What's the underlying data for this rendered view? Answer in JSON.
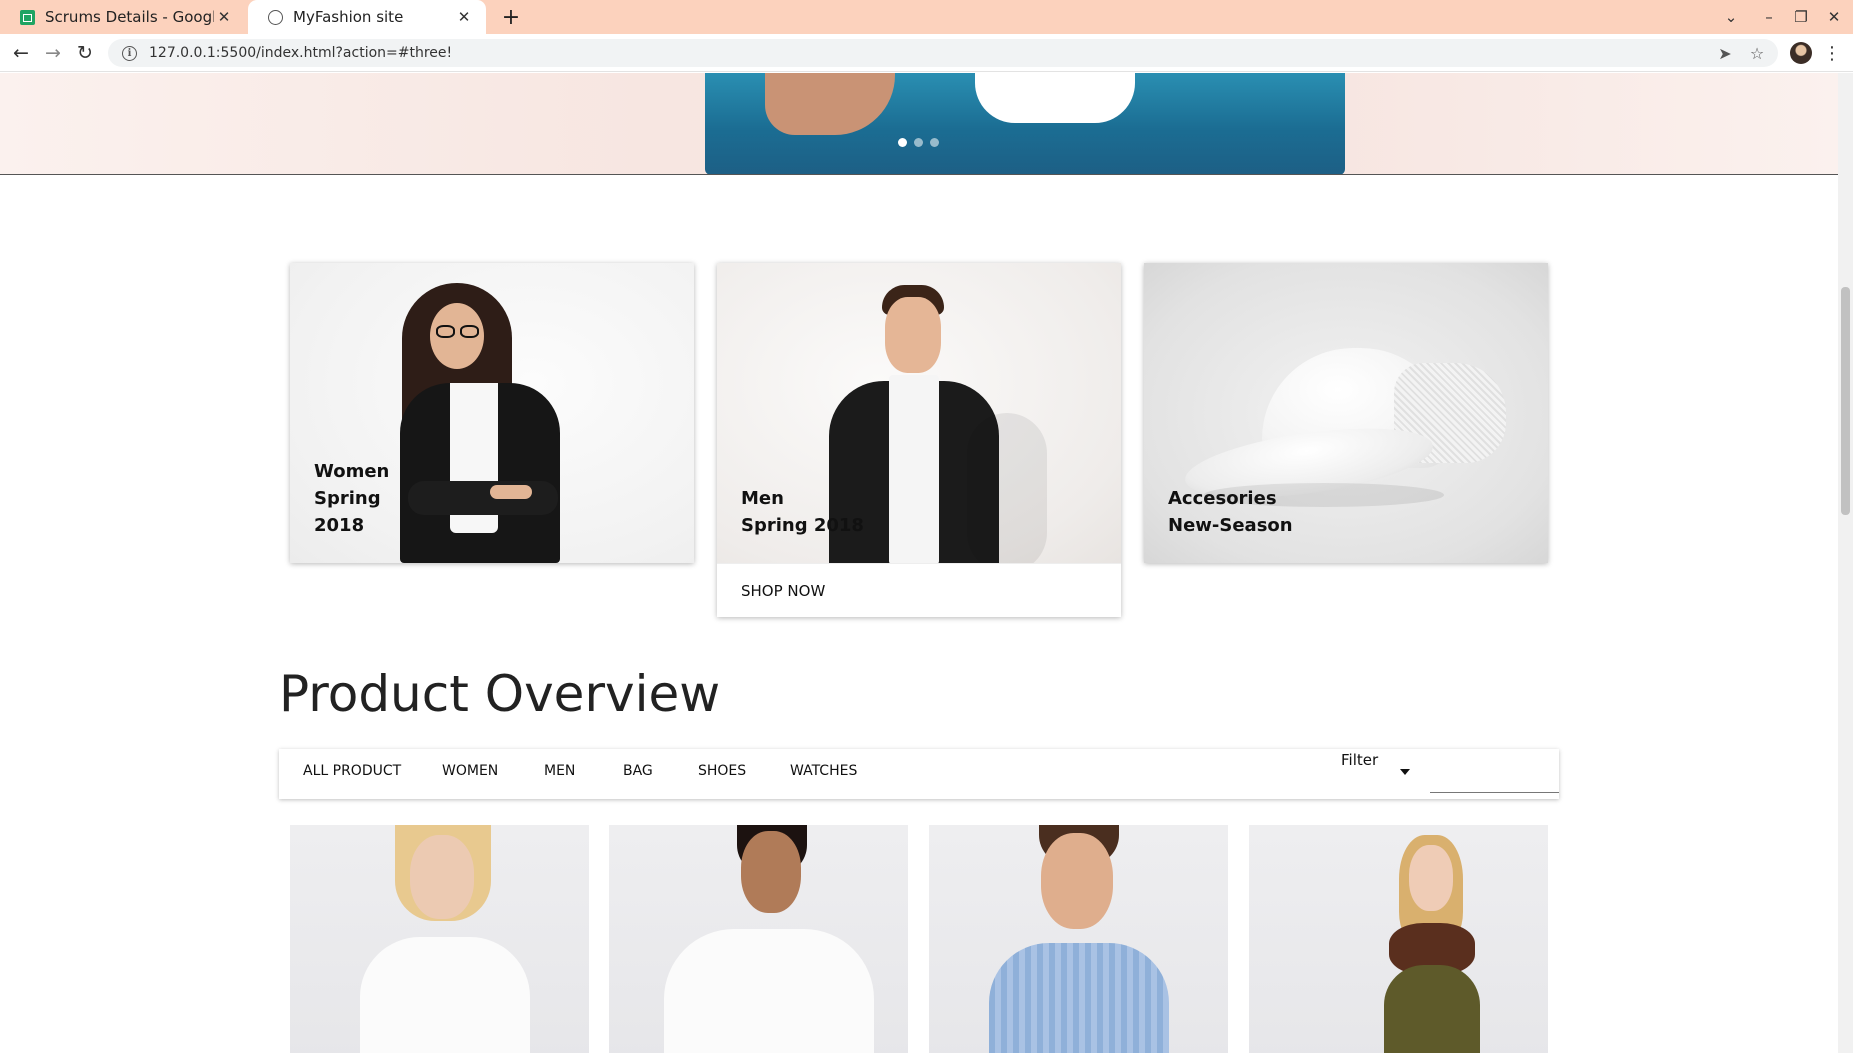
{
  "browser": {
    "tabs": [
      {
        "title": "Scrums Details - Google Sheets",
        "icon": "sheets-icon",
        "active": false
      },
      {
        "title": "MyFashion site",
        "icon": "globe-icon",
        "active": true
      }
    ],
    "url": "127.0.0.1:5500/index.html?action=#three!",
    "icons": {
      "close": "✕",
      "new_tab": "+",
      "back": "←",
      "forward": "→",
      "reload": "↻",
      "info": "i",
      "send": "➤",
      "bookmark": "☆",
      "menu": "⋮",
      "tab_list": "⌄",
      "minimize": "–",
      "restore": "❐",
      "window_close": "✕"
    }
  },
  "hero": {
    "dots": 3,
    "active_dot": 0
  },
  "categories": [
    {
      "lines": [
        "Women",
        "Spring",
        "2018"
      ]
    },
    {
      "lines": [
        "Men",
        "Spring 2018"
      ],
      "cta": "SHOP NOW"
    },
    {
      "lines": [
        "Accesories",
        "New-Season"
      ]
    }
  ],
  "product_overview": {
    "title": "Product Overview",
    "tabs": [
      "ALL PRODUCT",
      "WOMEN",
      "MEN",
      "BAG",
      "SHOES",
      "WATCHES"
    ],
    "filter_label": "Filter"
  },
  "colors": {
    "tab_strip": "#fcd2bd",
    "denim": "#1b6d93"
  }
}
